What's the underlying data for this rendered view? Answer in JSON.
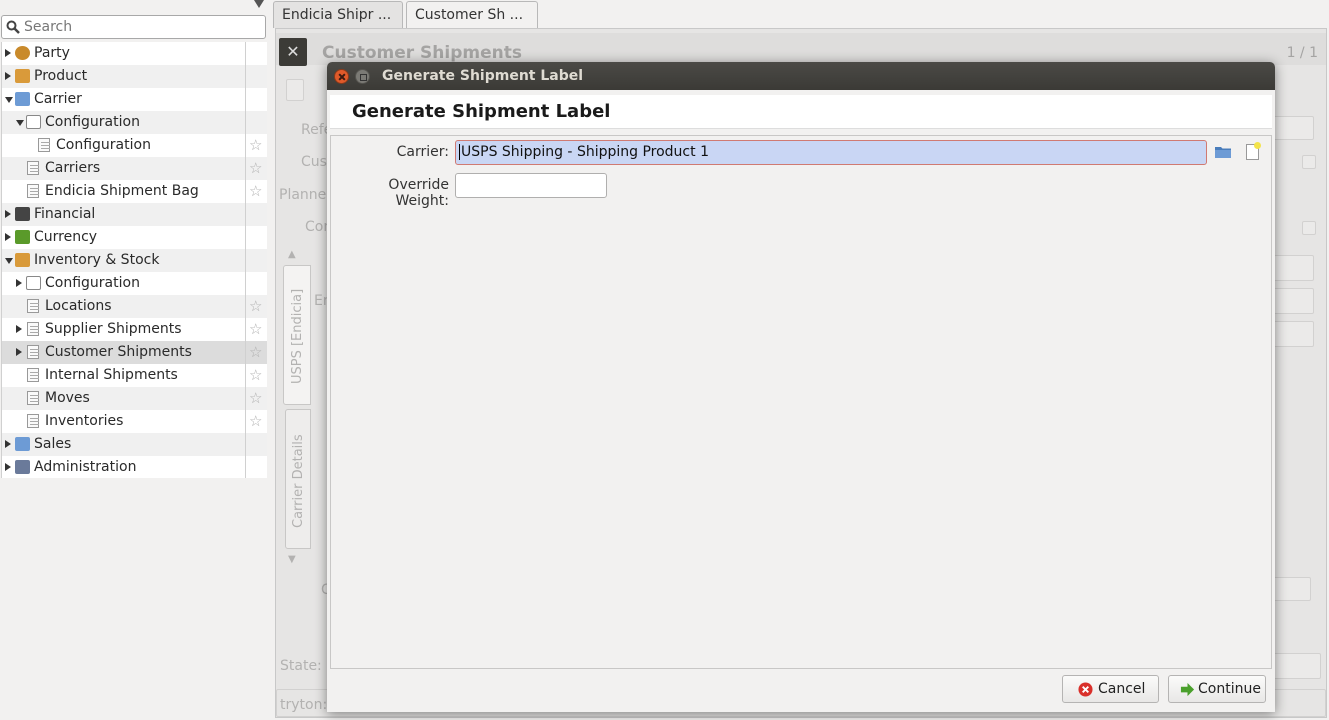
{
  "search": {
    "placeholder": "Search"
  },
  "tree": [
    {
      "label": "Party",
      "icon": "party-icon",
      "expander": "closed",
      "level": 0,
      "star": false
    },
    {
      "label": "Product",
      "icon": "product-icon",
      "expander": "closed",
      "level": 0,
      "star": false
    },
    {
      "label": "Carrier",
      "icon": "folder-icon",
      "expander": "open",
      "level": 0,
      "star": false
    },
    {
      "label": "Configuration",
      "icon": "configuration-icon",
      "expander": "open",
      "level": 1,
      "star": false
    },
    {
      "label": "Configuration",
      "icon": "document-icon",
      "expander": "none",
      "level": 2,
      "star": true
    },
    {
      "label": "Carriers",
      "icon": "document-icon",
      "expander": "none",
      "level": 1,
      "star": true
    },
    {
      "label": "Endicia Shipment Bag",
      "icon": "document-icon",
      "expander": "none",
      "level": 1,
      "star": true
    },
    {
      "label": "Financial",
      "icon": "calculator-icon",
      "expander": "closed",
      "level": 0,
      "star": false
    },
    {
      "label": "Currency",
      "icon": "currency-icon",
      "expander": "closed",
      "level": 0,
      "star": false
    },
    {
      "label": "Inventory & Stock",
      "icon": "inventory-icon",
      "expander": "open",
      "level": 0,
      "star": false
    },
    {
      "label": "Configuration",
      "icon": "configuration-icon",
      "expander": "closed",
      "level": 1,
      "star": false
    },
    {
      "label": "Locations",
      "icon": "document-icon",
      "expander": "none",
      "level": 1,
      "star": true
    },
    {
      "label": "Supplier Shipments",
      "icon": "document-icon",
      "expander": "closed",
      "level": 1,
      "star": true
    },
    {
      "label": "Customer Shipments",
      "icon": "document-icon",
      "expander": "closed",
      "level": 1,
      "star": true,
      "selected": true
    },
    {
      "label": "Internal Shipments",
      "icon": "document-icon",
      "expander": "none",
      "level": 1,
      "star": true
    },
    {
      "label": "Moves",
      "icon": "document-icon",
      "expander": "none",
      "level": 1,
      "star": true
    },
    {
      "label": "Inventories",
      "icon": "document-icon",
      "expander": "none",
      "level": 1,
      "star": true
    },
    {
      "label": "Sales",
      "icon": "folder-icon",
      "expander": "closed",
      "level": 0,
      "star": false
    },
    {
      "label": "Administration",
      "icon": "tools-icon",
      "expander": "closed",
      "level": 0,
      "star": false
    }
  ],
  "tabs": [
    {
      "label": "Endicia Shipr ..."
    },
    {
      "label": "Customer Sh ...",
      "active": true
    }
  ],
  "main": {
    "title": "Customer Shipments",
    "counter": "1 / 1",
    "labels": {
      "reference": "Refe",
      "customer": "Cust",
      "planned": "Planned",
      "contact": "Con",
      "endicia": "En",
      "c": "C",
      "state": "State:",
      "status_bar": "tryton:"
    },
    "vtabs": [
      "USPS [Endicia]",
      "Carrier Details"
    ]
  },
  "dialog": {
    "window_title": "Generate Shipment Label",
    "heading": "Generate Shipment Label",
    "carrier_label": "Carrier:",
    "carrier_value": "USPS Shipping - Shipping Product 1",
    "weight_label": "Override Weight:",
    "weight_value": "",
    "cancel_label": "Cancel",
    "continue_label": "Continue"
  },
  "colors": {
    "titlebar": "#3c3b37",
    "selection": "#c9d6f4",
    "close_button": "#e05a2a"
  }
}
